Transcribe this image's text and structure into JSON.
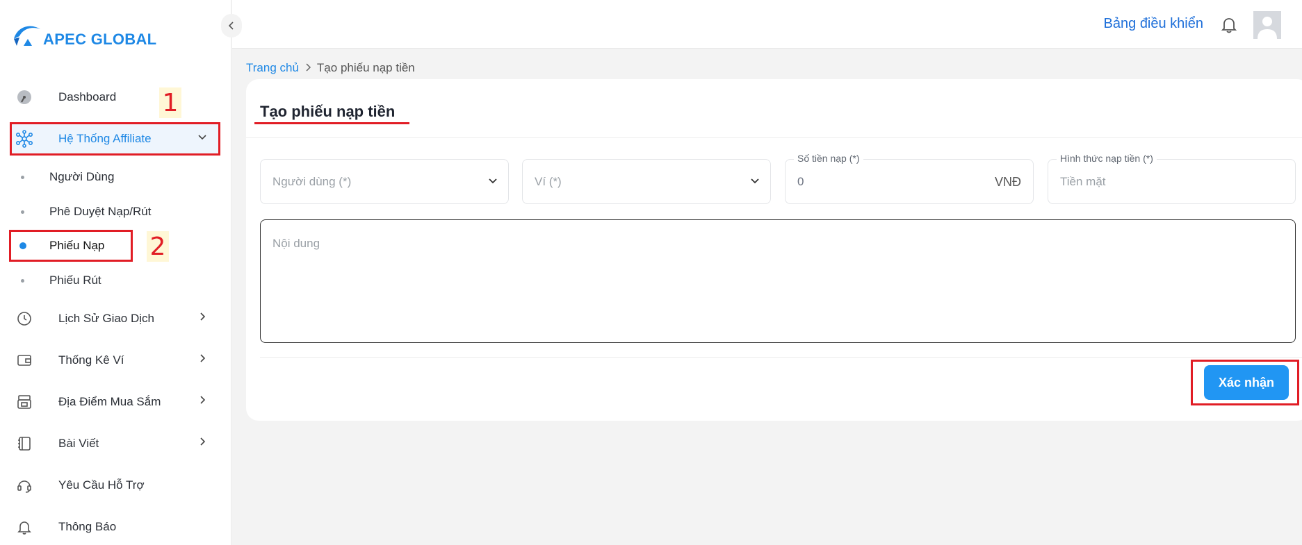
{
  "brand": {
    "name": "APEC GLOBAL",
    "color": "#1e88e5"
  },
  "header": {
    "dashboard_link": "Bảng điều khiển"
  },
  "sidebar": {
    "items": [
      {
        "label": "Dashboard",
        "icon": "gauge-icon"
      },
      {
        "label": "Hệ Thống Affiliate",
        "icon": "network-icon",
        "expanded": true
      },
      {
        "label": "Người Dùng",
        "sub": true
      },
      {
        "label": "Phê Duyệt Nạp/Rút",
        "sub": true
      },
      {
        "label": "Phiếu Nạp",
        "sub": true,
        "current": true
      },
      {
        "label": "Phiếu Rút",
        "sub": true
      },
      {
        "label": "Lịch Sử Giao Dịch",
        "icon": "history-icon"
      },
      {
        "label": "Thống Kê Ví",
        "icon": "wallet-icon"
      },
      {
        "label": "Địa Điểm Mua Sắm",
        "icon": "store-icon"
      },
      {
        "label": "Bài Viết",
        "icon": "notebook-icon"
      },
      {
        "label": "Yêu Cầu Hỗ Trợ",
        "icon": "support-icon"
      },
      {
        "label": "Thông Báo",
        "icon": "bell-icon"
      }
    ]
  },
  "annotations": {
    "one": "1",
    "two": "2"
  },
  "breadcrumb": {
    "home": "Trang chủ",
    "current": "Tạo phiếu nạp tiền"
  },
  "form": {
    "title": "Tạo phiếu nạp tiền",
    "user_placeholder": "Người dùng (*)",
    "wallet_placeholder": "Ví (*)",
    "amount_label": "Số tiền nạp (*)",
    "amount_value": "0",
    "amount_currency": "VNĐ",
    "method_label": "Hình thức nạp tiền (*)",
    "method_placeholder": "Tiền mặt",
    "content_placeholder": "Nội dung",
    "submit_label": "Xác nhận"
  },
  "colors": {
    "accent": "#2196f3",
    "annotation": "#e11d25"
  }
}
